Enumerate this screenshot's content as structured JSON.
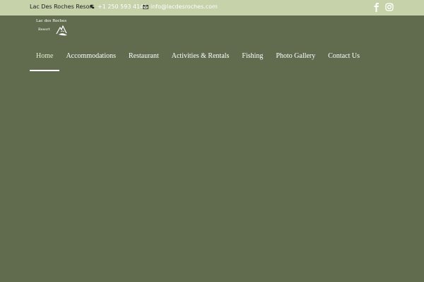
{
  "topbar": {
    "resort_name": "Lac Des Roches Resort",
    "phone": "+1 250 593 4141",
    "email": "info@lacdesroches.com",
    "social": [
      "facebook-icon",
      "instagram-icon"
    ]
  },
  "logo": {
    "line1": "Lac des Roches",
    "line2": "Resort"
  },
  "nav": {
    "items": [
      {
        "label": "Home",
        "active": true
      },
      {
        "label": "Accommodations"
      },
      {
        "label": "Restaurant"
      },
      {
        "label": "Activities & Rentals"
      },
      {
        "label": "Fishing"
      },
      {
        "label": "Photo Gallery"
      },
      {
        "label": "Contact Us"
      }
    ]
  },
  "colors": {
    "topbar_bg": "#c5d2aa",
    "page_bg": "#616c4f",
    "text": "#ffffff"
  }
}
